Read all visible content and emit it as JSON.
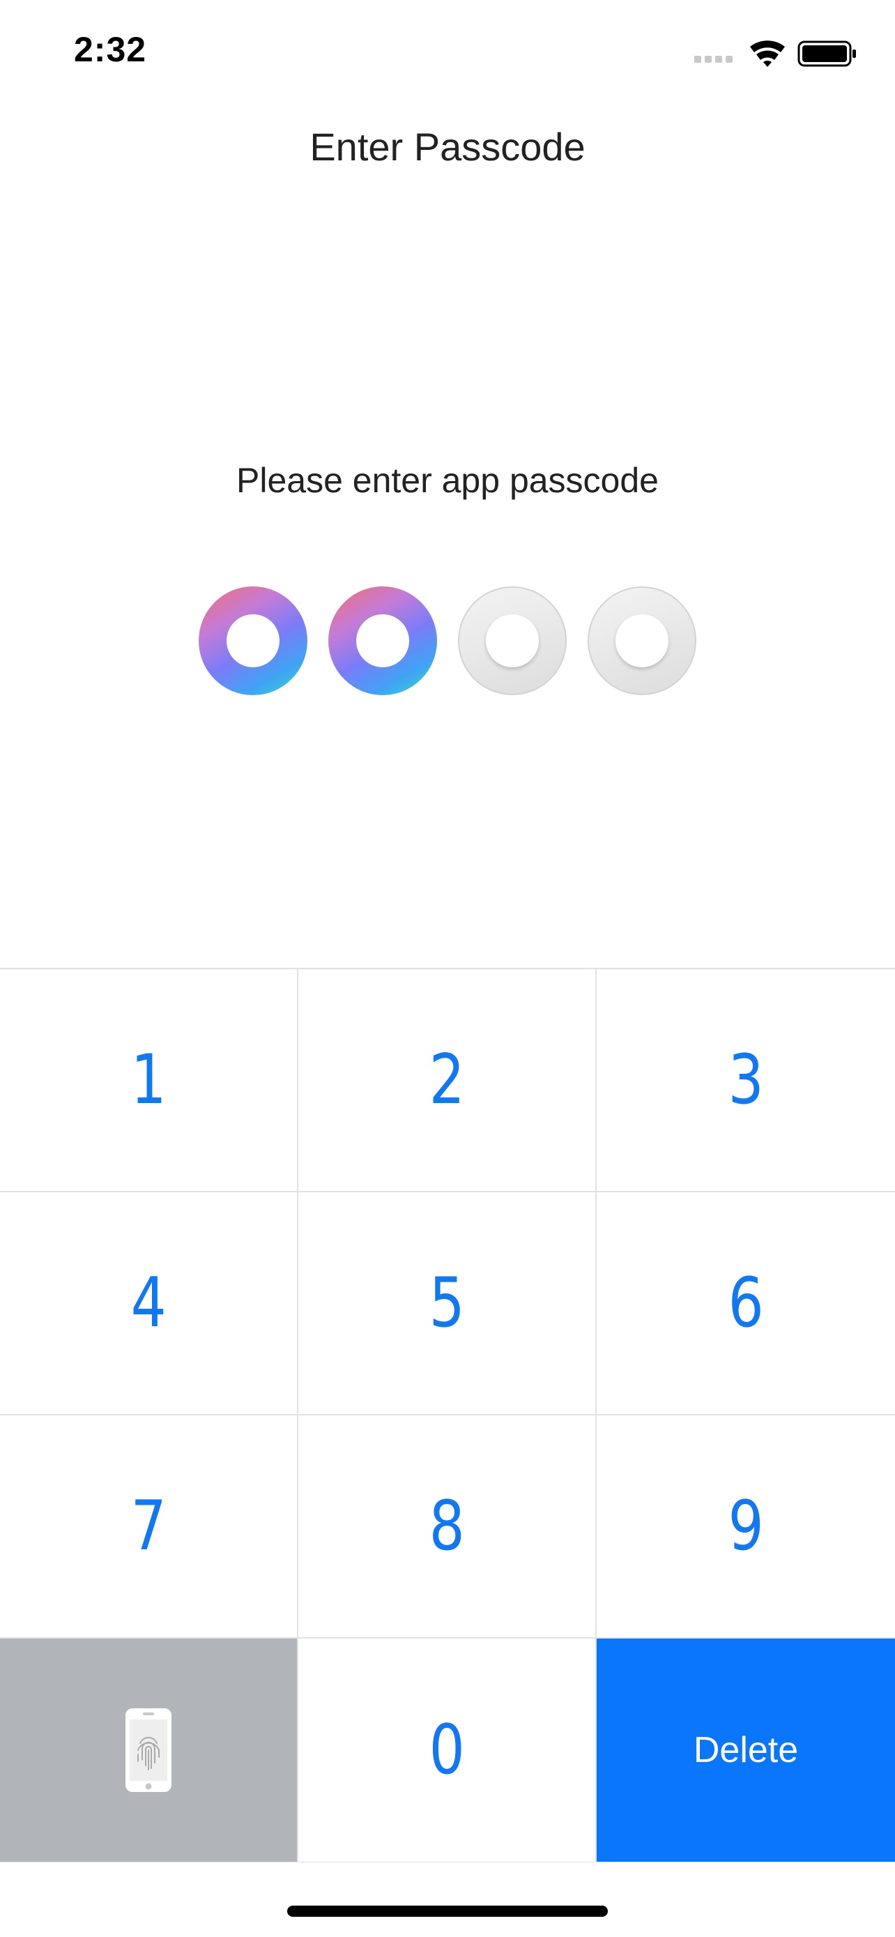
{
  "status": {
    "time": "2:32",
    "signal_icon": "signal-dots-icon",
    "wifi_icon": "wifi-icon",
    "battery_icon": "battery-icon"
  },
  "header": {
    "title": "Enter Passcode"
  },
  "prompt": {
    "text": "Please enter app passcode"
  },
  "passcode": {
    "length": 4,
    "entered": 2
  },
  "keypad": {
    "keys": [
      "1",
      "2",
      "3",
      "4",
      "5",
      "6",
      "7",
      "8",
      "9",
      "0"
    ],
    "biometric_icon": "phone-fingerprint-icon",
    "delete_label": "Delete"
  },
  "colors": {
    "accent": "#1178F5",
    "delete_bg": "#0A76FB",
    "biometric_bg": "#B1B4B8",
    "dot_gradient": [
      "#F26F74",
      "#7B7CF8",
      "#2FE0CF"
    ],
    "dot_empty": "#DCDCDC"
  }
}
